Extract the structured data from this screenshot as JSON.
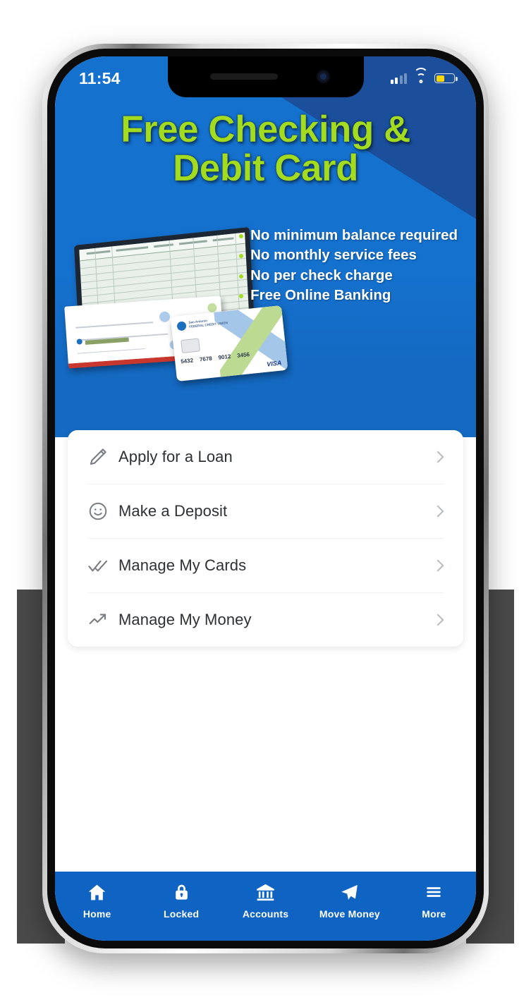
{
  "status_bar": {
    "time": "11:54",
    "cellular_icon": "cellular-signal-icon",
    "wifi_icon": "wifi-icon",
    "battery_icon": "battery-low-power-icon",
    "battery_color": "#FFD60A"
  },
  "hero": {
    "title_line1": "Free Checking &",
    "title_line2": "Debit Card",
    "title_color": "#A3DC1F",
    "background_color": "#1571CE",
    "stripe_color": "#1B4F9C",
    "bullets": [
      "No minimum balance required",
      "No monthly service fees",
      "No per check charge",
      "Free Online Banking"
    ],
    "artwork": {
      "alt": "checkbook register with check and debit card",
      "card_brand": "San Antonio",
      "card_brand_sub": "FEDERAL CREDIT UNION",
      "card_number_groups": [
        "5432",
        "7678",
        "9012",
        "3456"
      ],
      "card_network": "VISA"
    }
  },
  "quick_actions": [
    {
      "label": "Apply for a Loan",
      "icon": "pencil-icon",
      "chevron": "chevron-right-icon"
    },
    {
      "label": "Make a Deposit",
      "icon": "smiley-face-icon",
      "chevron": "chevron-right-icon"
    },
    {
      "label": "Manage My Cards",
      "icon": "double-check-icon",
      "chevron": "chevron-right-icon"
    },
    {
      "label": "Manage My Money",
      "icon": "trending-up-icon",
      "chevron": "chevron-right-icon"
    }
  ],
  "tab_bar": {
    "background_color": "#0E63C3",
    "items": [
      {
        "label": "Home",
        "icon": "home-icon"
      },
      {
        "label": "Locked",
        "icon": "lock-icon"
      },
      {
        "label": "Accounts",
        "icon": "bank-icon"
      },
      {
        "label": "Move Money",
        "icon": "paper-plane-icon"
      },
      {
        "label": "More",
        "icon": "hamburger-menu-icon"
      }
    ]
  }
}
